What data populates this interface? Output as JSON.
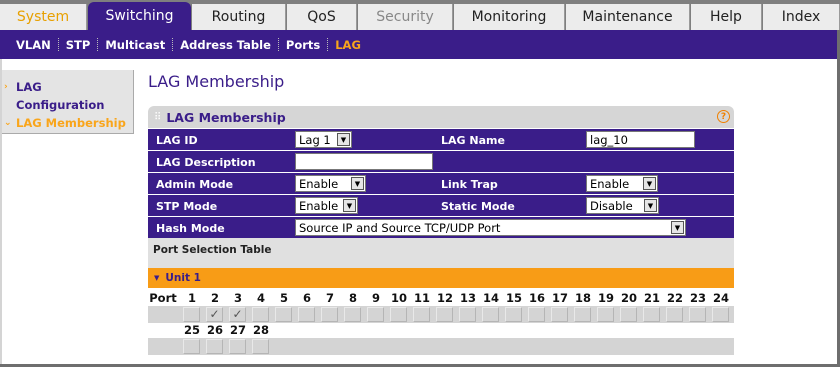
{
  "top_tabs": [
    {
      "label": "System",
      "state": "first"
    },
    {
      "label": "Switching",
      "state": "selected"
    },
    {
      "label": "Routing",
      "state": "normal"
    },
    {
      "label": "QoS",
      "state": "normal"
    },
    {
      "label": "Security",
      "state": "dim"
    },
    {
      "label": "Monitoring",
      "state": "normal"
    },
    {
      "label": "Maintenance",
      "state": "normal"
    },
    {
      "label": "Help",
      "state": "normal"
    },
    {
      "label": "Index",
      "state": "normal"
    }
  ],
  "sub_nav": [
    {
      "label": "VLAN",
      "active": false
    },
    {
      "label": "STP",
      "active": false
    },
    {
      "label": "Multicast",
      "active": false
    },
    {
      "label": "Address Table",
      "active": false
    },
    {
      "label": "Ports",
      "active": false
    },
    {
      "label": "LAG",
      "active": true
    }
  ],
  "left_menu": [
    {
      "label_line1": "LAG",
      "label_line2": "Configuration",
      "arrow": "›",
      "active": false
    },
    {
      "label_line1": "LAG Membership",
      "label_line2": "",
      "arrow": "⌄",
      "active": true
    }
  ],
  "page_title": "LAG Membership",
  "panel": {
    "title": "LAG Membership",
    "help_symbol": "?",
    "grip_symbol": "⠿"
  },
  "form": {
    "lag_id_label": "LAG ID",
    "lag_id_value": "Lag 1",
    "lag_name_label": "LAG Name",
    "lag_name_value": "lag_10",
    "lag_description_label": "LAG Description",
    "lag_description_value": "",
    "admin_mode_label": "Admin Mode",
    "admin_mode_value": "Enable",
    "link_trap_label": "Link Trap",
    "link_trap_value": "Enable",
    "stp_mode_label": "STP Mode",
    "stp_mode_value": "Enable",
    "static_mode_label": "Static Mode",
    "static_mode_value": "Disable",
    "hash_mode_label": "Hash Mode",
    "hash_mode_value": "Source IP and Source TCP/UDP Port"
  },
  "port_selection_title": "Port Selection Table",
  "unit_label": "Unit 1",
  "port_header_label": "Port",
  "ports_row1": [
    "1",
    "2",
    "3",
    "4",
    "5",
    "6",
    "7",
    "8",
    "9",
    "10",
    "11",
    "12",
    "13",
    "14",
    "15",
    "16",
    "17",
    "18",
    "19",
    "20",
    "21",
    "22",
    "23",
    "24"
  ],
  "ports_row2": [
    "25",
    "26",
    "27",
    "28"
  ],
  "checked_ports": [
    "2",
    "3"
  ],
  "check_glyph": "✓",
  "colors": {
    "brand_purple": "#3a1d89",
    "accent_orange": "#f89c16",
    "active_text_orange": "#f9a51b"
  }
}
